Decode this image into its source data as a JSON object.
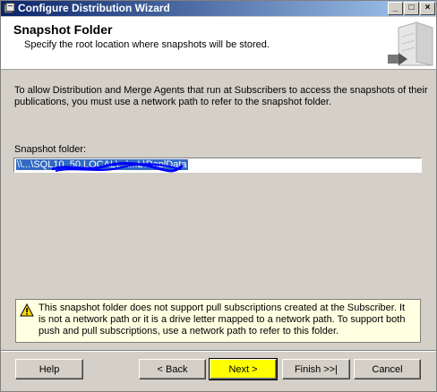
{
  "window": {
    "title": "Configure Distribution Wizard",
    "controls": {
      "minimize": "_",
      "maximize": "□",
      "close": "×"
    }
  },
  "header": {
    "title": "Snapshot Folder",
    "subtitle": "Specify the root location where snapshots will be stored."
  },
  "main": {
    "description": "To allow Distribution and Merge Agents that run at Subscribers to access the snapshots of their publications, you must use a network path to refer to the snapshot folder.",
    "folder_label": "Snapshot folder:",
    "folder_value": "\\\\...\\SQL10_50.LOCAL\\...\\...L\\ReplData"
  },
  "warning": {
    "icon": "warning-icon",
    "text": "This snapshot folder does not support pull subscriptions created at the Subscriber. It is not a network path or it is a drive letter mapped to a network path. To support both push and pull subscriptions, use a network path to refer to this folder."
  },
  "buttons": {
    "help": "Help",
    "back": "< Back",
    "next": "Next >",
    "finish": "Finish >>|",
    "cancel": "Cancel"
  },
  "colors": {
    "titlebar_start": "#0a246a",
    "titlebar_end": "#a6caf0",
    "dialog_bg": "#d4d0c8",
    "selection": "#316ac5",
    "warning_bg": "#ffffe1",
    "highlight": "#ffff00",
    "redaction": "#0000ff"
  }
}
